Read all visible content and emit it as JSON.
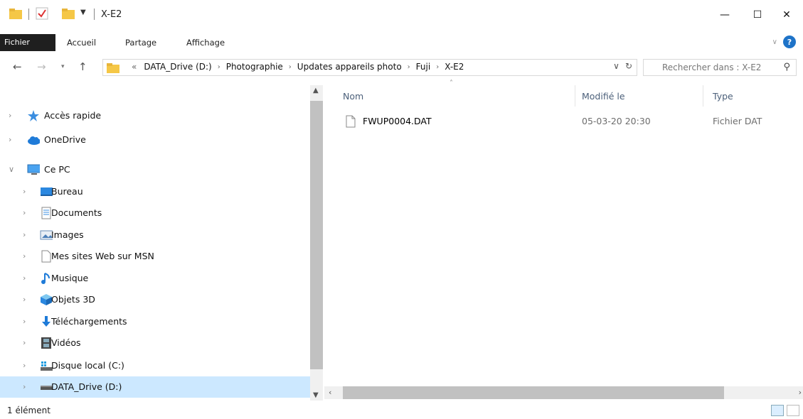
{
  "window": {
    "title": "X-E2",
    "controls": {
      "minimize": "—",
      "maximize": "☐",
      "close": "✕"
    }
  },
  "ribbon": {
    "tabs": [
      "Fichier",
      "Accueil",
      "Partage",
      "Affichage"
    ]
  },
  "address": {
    "overflow": "«",
    "crumbs": [
      "DATA_Drive (D:)",
      "Photographie",
      "Updates appareils photo",
      "Fuji",
      "X-E2"
    ]
  },
  "search": {
    "placeholder": "Rechercher dans : X-E2"
  },
  "navigation": {
    "items": [
      {
        "label": "Accès rapide",
        "icon": "star-icon",
        "level": 0,
        "expanded": false,
        "selected": false
      },
      {
        "label": "OneDrive",
        "icon": "cloud-icon",
        "level": 0,
        "expanded": false,
        "selected": false
      },
      {
        "label": "Ce PC",
        "icon": "computer-icon",
        "level": 0,
        "expanded": true,
        "selected": false
      },
      {
        "label": "Bureau",
        "icon": "desktop-icon",
        "level": 1,
        "expanded": false,
        "selected": false
      },
      {
        "label": "Documents",
        "icon": "documents-icon",
        "level": 1,
        "expanded": false,
        "selected": false
      },
      {
        "label": "Images",
        "icon": "images-icon",
        "level": 1,
        "expanded": false,
        "selected": false
      },
      {
        "label": "Mes sites Web sur MSN",
        "icon": "blank-file-icon",
        "level": 1,
        "expanded": false,
        "selected": false
      },
      {
        "label": "Musique",
        "icon": "music-note-icon",
        "level": 1,
        "expanded": false,
        "selected": false
      },
      {
        "label": "Objets 3D",
        "icon": "cube-icon",
        "level": 1,
        "expanded": false,
        "selected": false
      },
      {
        "label": "Téléchargements",
        "icon": "download-arrow-icon",
        "level": 1,
        "expanded": false,
        "selected": false
      },
      {
        "label": "Vidéos",
        "icon": "film-icon",
        "level": 1,
        "expanded": false,
        "selected": false
      },
      {
        "label": "Disque local (C:)",
        "icon": "windows-drive-icon",
        "level": 1,
        "expanded": false,
        "selected": false
      },
      {
        "label": "DATA_Drive (D:)",
        "icon": "drive-icon",
        "level": 1,
        "expanded": false,
        "selected": true
      }
    ]
  },
  "columns": {
    "name": "Nom",
    "modified": "Modifié le",
    "type": "Type"
  },
  "files": [
    {
      "name": "FWUP0004.DAT",
      "modified": "05-03-20 20:30",
      "type": "Fichier DAT"
    }
  ],
  "status": {
    "count": "1 élément"
  },
  "colors": {
    "selection": "#cce8ff",
    "accent": "#1e73c8",
    "header_text": "#4c607a",
    "folder": "#f5c746"
  }
}
